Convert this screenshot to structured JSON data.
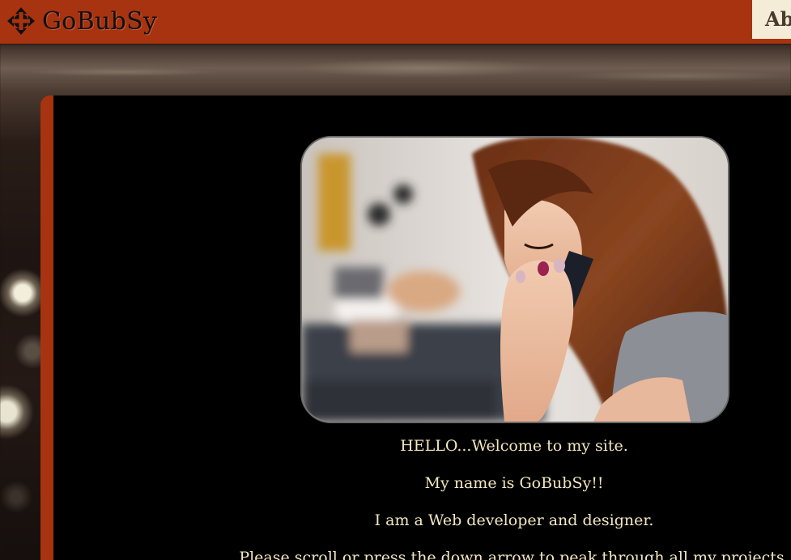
{
  "header": {
    "brand_icon": "move-arrows-icon",
    "brand_name": "GoBubSy",
    "nav_about_label": "Ab"
  },
  "main": {
    "hero_image": "woman-on-phone-photo",
    "lines": [
      "HELLO...Welcome to my site.",
      "My name is GoBubSy!!",
      "I am a Web developer and designer.",
      "Please scroll or press the down arrow to peak through all my projects."
    ]
  },
  "colors": {
    "header_bg": "#a83311",
    "panel_bg": "#000000",
    "text": "#f3e7c0",
    "nav_button_bg": "#f5ecd8"
  }
}
